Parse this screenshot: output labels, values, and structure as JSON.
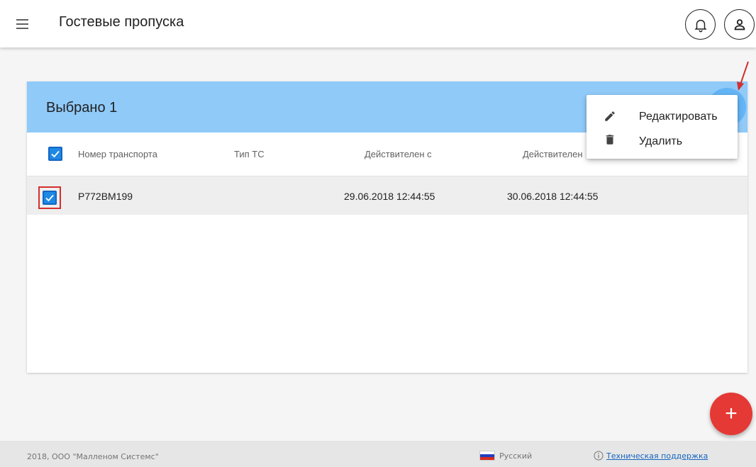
{
  "header": {
    "title": "Гостевые пропуска",
    "icons": [
      "menu-icon",
      "bell-icon",
      "user-icon"
    ]
  },
  "selection": {
    "text": "Выбрано 1"
  },
  "table": {
    "columns": [
      "Номер транспорта",
      "Тип ТС",
      "Действителен с",
      "Действителен"
    ],
    "rows": [
      {
        "plate": "Р772ВМ199",
        "type": "",
        "valid_from": "29.06.2018 12:44:55",
        "valid_to": "30.06.2018 12:44:55",
        "selected": true
      }
    ]
  },
  "context_menu": {
    "items": [
      {
        "label": "Редактировать",
        "icon": "pencil-icon"
      },
      {
        "label": "Удалить",
        "icon": "trash-icon"
      }
    ]
  },
  "fab": {
    "label": "+"
  },
  "footer": {
    "copyright": "2018, ООО \"Малленом Системс\"",
    "language": "Русский",
    "support": "Техническая поддержка"
  },
  "colors": {
    "selection_bar": "#90caf9",
    "accent": "#1e88e5",
    "fab": "#e53935",
    "annotation": "#d32f2f"
  }
}
